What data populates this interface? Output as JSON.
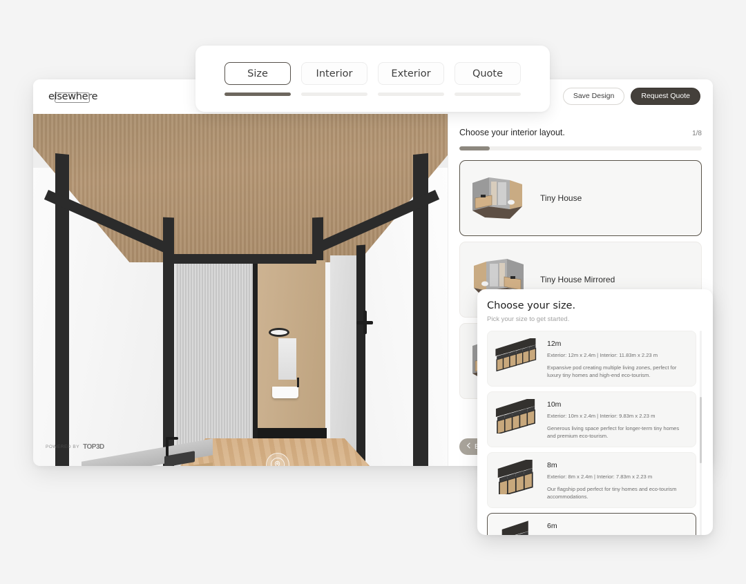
{
  "tabbar": {
    "tabs": [
      {
        "label": "Size",
        "active": true,
        "progress": 100
      },
      {
        "label": "Interior",
        "active": false,
        "progress": 0
      },
      {
        "label": "Exterior",
        "active": false,
        "progress": 0
      },
      {
        "label": "Quote",
        "active": false,
        "progress": 0
      }
    ]
  },
  "header": {
    "logo": "elsewhere",
    "save_label": "Save Design",
    "quote_label": "Request Quote"
  },
  "viewport": {
    "watermark_prefix": "POWERED BY",
    "watermark_logo": "TOP3D",
    "hotspots": [
      {
        "name": "hotspot-upper",
        "icon": "map-pin-icon"
      },
      {
        "name": "hotspot-lower",
        "icon": "map-pin-icon"
      }
    ]
  },
  "panel": {
    "title": "Choose your interior layout.",
    "step": "1/8",
    "progress_percent": 12.5,
    "back_label": "Back",
    "back_icon": "chevron-left-icon",
    "layouts": [
      {
        "label": "Tiny House",
        "selected": true
      },
      {
        "label": "Tiny House Mirrored",
        "selected": false
      },
      {
        "label": "",
        "selected": false
      }
    ]
  },
  "size_panel": {
    "title": "Choose your size.",
    "subtitle": "Pick your size to get started.",
    "scroll_percent": 32,
    "sizes": [
      {
        "name": "12m",
        "dims": "Exterior: 12m x 2.4m | Interior:  11.83m x 2.23 m",
        "desc": "Expansive pod creating multiple living zones, perfect for luxury tiny homes and high-end eco-tourism.",
        "selected": false
      },
      {
        "name": "10m",
        "dims": "Exterior: 10m x 2.4m | Interior:  9.83m x 2.23 m",
        "desc": "Generous living space perfect for longer-term tiny homes and premium eco-tourism.",
        "selected": false
      },
      {
        "name": "8m",
        "dims": "Exterior: 8m x 2.4m | Interior:  7.83m x 2.23 m",
        "desc": "Our flagship pod perfect for tiny homes and eco-tourism accommodations.",
        "selected": false
      },
      {
        "name": "6m",
        "dims": "",
        "desc": "",
        "selected": true
      }
    ]
  },
  "colors": {
    "accent_dark": "#44403b",
    "panel_bg": "#ffffff",
    "page_bg": "#f4f4f4",
    "muted": "#6f6f6f",
    "progress_fill": "#8d887f"
  }
}
